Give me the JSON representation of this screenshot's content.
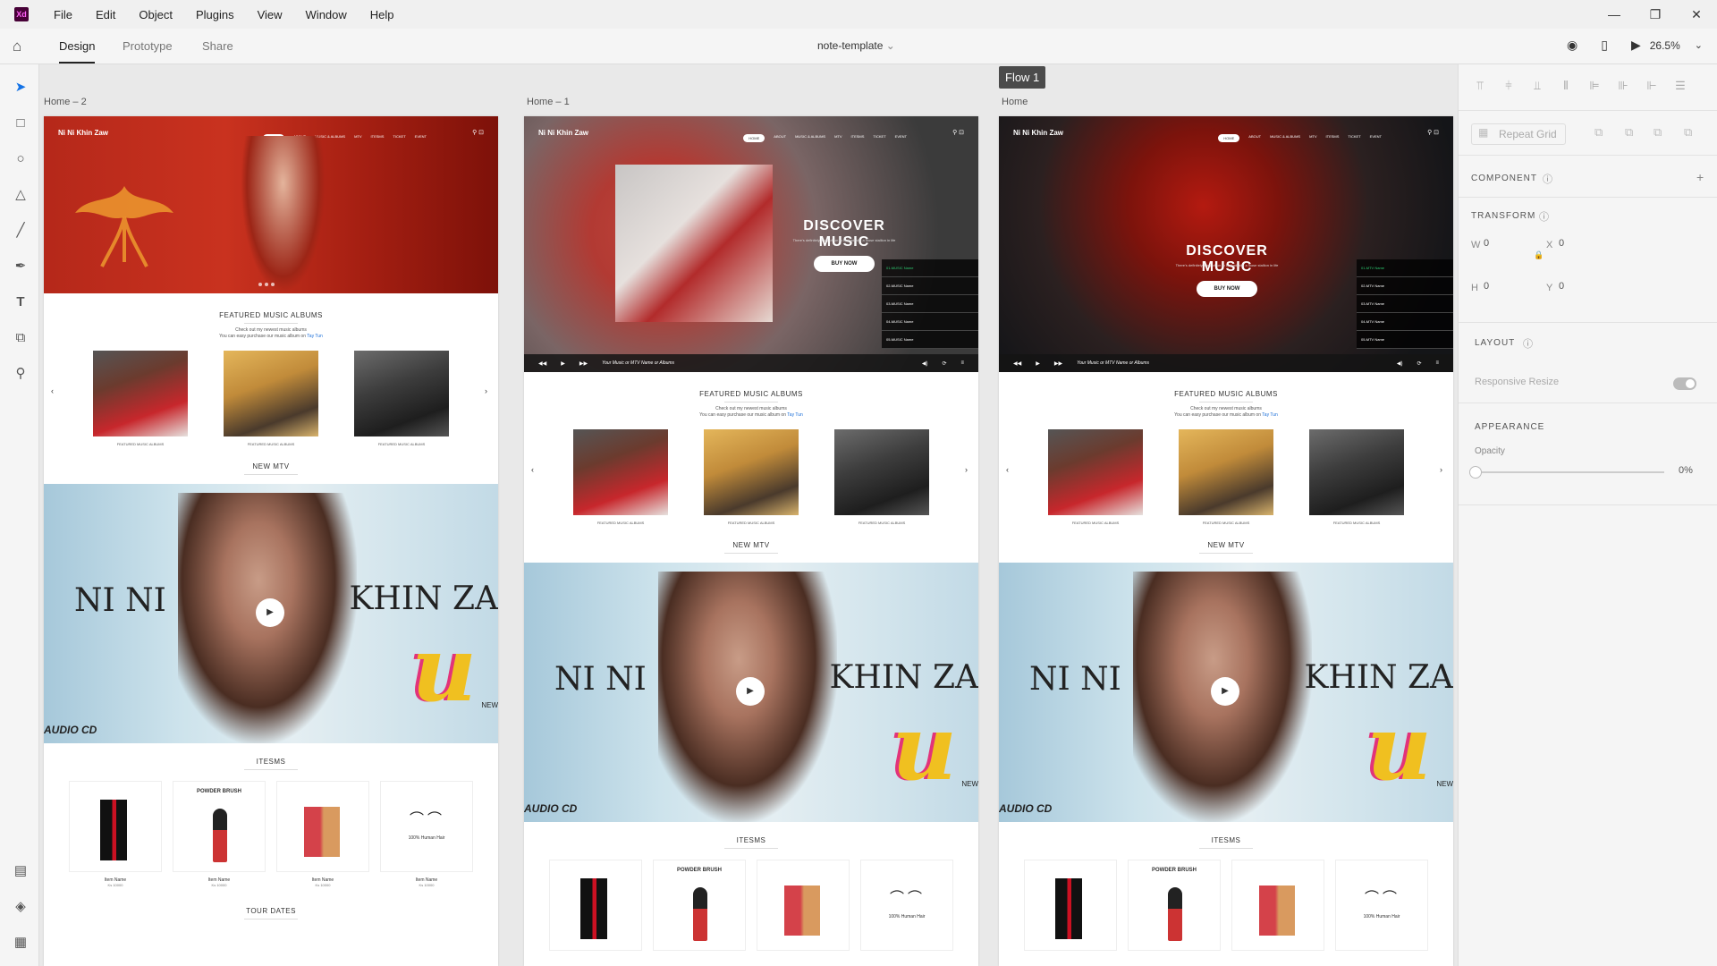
{
  "app": {
    "logo": "Xd"
  },
  "menu": [
    "File",
    "Edit",
    "Object",
    "Plugins",
    "View",
    "Window",
    "Help"
  ],
  "toolbar": {
    "tabs": [
      "Design",
      "Prototype",
      "Share"
    ],
    "doc_title": "note-template",
    "zoom": "26.5%"
  },
  "window": {
    "minimize": "—",
    "restore": "❐",
    "close": "✕"
  },
  "tools": [
    "select-tool",
    "rectangle-tool",
    "ellipse-tool",
    "triangle-tool",
    "line-tool",
    "pen-tool",
    "text-tool",
    "artboard-tool",
    "zoom-tool"
  ],
  "canvas": {
    "flow_label": "Flow 1",
    "artboards": [
      {
        "label": "Home – 2"
      },
      {
        "label": "Home – 1"
      },
      {
        "label": "Home"
      }
    ]
  },
  "site": {
    "brand": "Ni Ni Khin Zaw",
    "nav": [
      "Home",
      "About",
      "Music & Albums",
      "MTV",
      "Itesms",
      "Ticket",
      "Event"
    ],
    "hero_title": "DISCOVER MUSIC",
    "hero_sub": "There's definitely a lay of fun to be had with a loose stallion in life",
    "buy_now": "BUY NOW",
    "playlist": [
      "01-MUSIC Name",
      "02-MUSIC Name",
      "03-MUSIC Name",
      "04-MUSIC Name",
      "05-MUSIC Name"
    ],
    "playlist_mtv": [
      "01-MTV Name",
      "02-MTV Name",
      "03-MTV Name",
      "04-MTV Name",
      "05-MTV Name"
    ],
    "player_text": "Your Music or MTV Name or Albums",
    "featured_title": "FEATURED MUSIC ALBUMS",
    "featured_sub1": "Check out my newest music albums",
    "featured_sub2": "You can easy purchase our music album on ",
    "featured_link": "Tay Tun",
    "album_caption": "FEATURED MUSIC ALBUMS",
    "mtv_title": "NEW MTV",
    "mtv_ni": "NI NI",
    "mtv_khin": "KHIN ZA",
    "mtv_u": "u",
    "mtv_audio": "AUDIO CD",
    "mtv_new": "NEW",
    "items_title": "ITESMS",
    "item_powder": "POWDER BRUSH",
    "item_hair": "100% Human Hair",
    "item_name": "Item Name",
    "item_price": "Ks 10000",
    "tour_title": "TOUR DATES"
  },
  "inspector": {
    "repeat_grid": "Repeat Grid",
    "component": "COMPONENT",
    "transform": "TRANSFORM",
    "w_label": "W",
    "w_value": "0",
    "x_label": "X",
    "x_value": "0",
    "h_label": "H",
    "h_value": "0",
    "y_label": "Y",
    "y_value": "0",
    "layout": "LAYOUT",
    "responsive_resize": "Responsive Resize",
    "appearance": "APPEARANCE",
    "opacity_label": "Opacity",
    "opacity_value": "0%"
  }
}
